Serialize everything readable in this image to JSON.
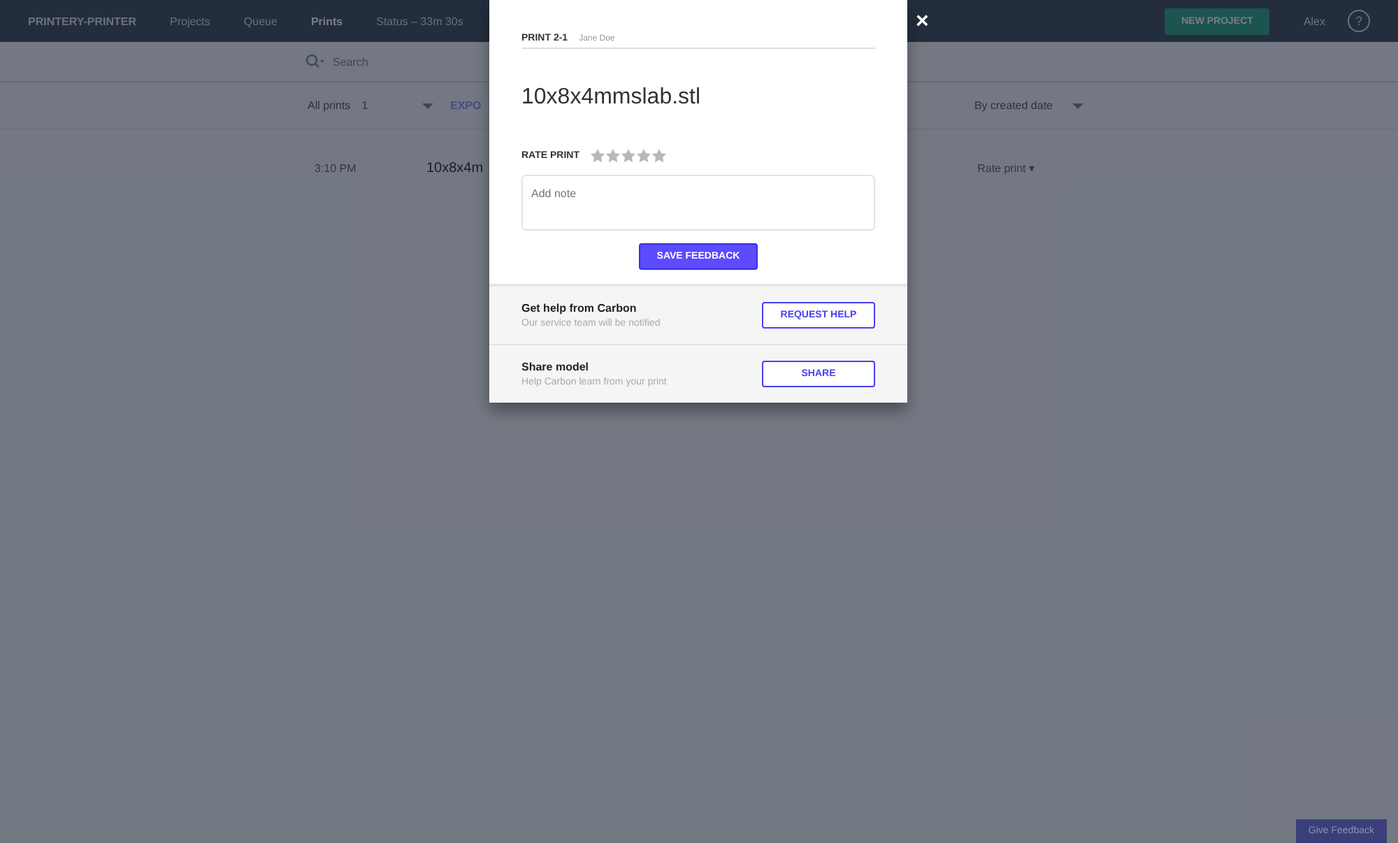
{
  "nav": {
    "brand": "PRINTERY-PRINTER",
    "items": [
      {
        "label": "Projects",
        "selected": false
      },
      {
        "label": "Queue",
        "selected": false
      },
      {
        "label": "Prints",
        "selected": true
      },
      {
        "label": "Status – 33m 30s",
        "selected": false
      }
    ],
    "new_project": "NEW PROJECT",
    "user": "Alex",
    "help": "?"
  },
  "search": {
    "placeholder": "Search"
  },
  "filters": {
    "scope": "All prints",
    "count": "1",
    "export": "EXPO",
    "sort": "By created date"
  },
  "row": {
    "time": "3:10 PM",
    "file": "10x8x4m",
    "rate": "Rate print ▾"
  },
  "feedback_tab": "Give Feedback",
  "modal": {
    "close": "×",
    "print_id": "PRINT 2-1",
    "owner": "Jane Doe",
    "filename": "10x8x4mmslab.stl",
    "rate_label": "RATE PRINT",
    "stars": 0,
    "note_placeholder": "Add note",
    "save": "SAVE FEEDBACK",
    "sections": [
      {
        "title": "Get help from Carbon",
        "subtitle": "Our service team will be notified",
        "button": "REQUEST HELP"
      },
      {
        "title": "Share model",
        "subtitle": "Help Carbon learn from your print",
        "button": "SHARE"
      }
    ]
  }
}
